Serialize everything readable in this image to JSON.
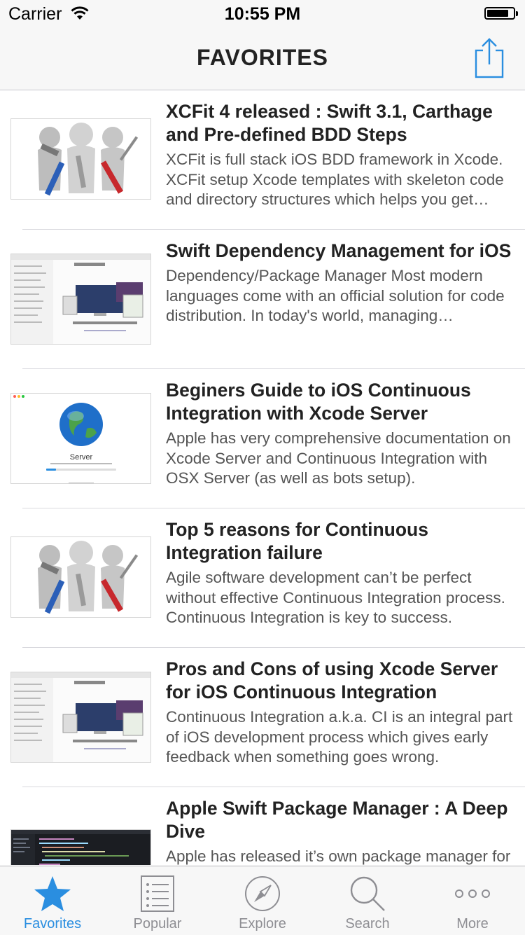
{
  "status_bar": {
    "carrier": "Carrier",
    "time": "10:55 PM"
  },
  "nav": {
    "title": "FAVORITES",
    "share_icon": "share-icon"
  },
  "articles": [
    {
      "title": "XCFit 4 released : Swift 3.1, Carthage and Pre-defined BDD Steps",
      "description": "XCFit is full stack iOS BDD framework in Xcode. XCFit setup Xcode templates with skeleton code and directory structures which helps you get started quickly.",
      "thumbnail": "team-tools-figures"
    },
    {
      "title": "Swift Dependency Management for iOS",
      "description": "Dependency/Package Manager Most modern languages come with an official solution for code distribution. In today's world, managing dependencies is essential.",
      "thumbnail": "macos-server-window"
    },
    {
      "title": "Beginers Guide to iOS Continuous Integration with Xcode Server",
      "description": "Apple has very comprehensive documentation on Xcode Server and Continuous Integration with OSX Server (as well as bots setup).",
      "thumbnail": "server-globe-window",
      "thumbnail_label": "Server"
    },
    {
      "title": "Top 5 reasons for Continuous Integration failure",
      "description": "Agile software development can’t be perfect without effective Continuous Integration process. Continuous Integration is key to success.",
      "thumbnail": "team-tools-figures"
    },
    {
      "title": "Pros and Cons of using Xcode Server for iOS Continuous Integration",
      "description": "Continuous Integration a.k.a. CI is an integral part of iOS development process which gives early feedback when something goes wrong.",
      "thumbnail": "macos-server-window"
    },
    {
      "title": "Apple Swift Package Manager : A Deep Dive",
      "description": "Apple has released it’s own package manager for Swift.",
      "thumbnail": "code-editor-dark"
    }
  ],
  "tabs": [
    {
      "label": "Favorites",
      "icon": "star-icon",
      "active": true
    },
    {
      "label": "Popular",
      "icon": "list-icon",
      "active": false
    },
    {
      "label": "Explore",
      "icon": "compass-icon",
      "active": false
    },
    {
      "label": "Search",
      "icon": "search-icon",
      "active": false
    },
    {
      "label": "More",
      "icon": "more-icon",
      "active": false
    }
  ],
  "colors": {
    "accent": "#2a8ee0",
    "inactive": "#8e8e93",
    "bar_background": "#f7f7f7"
  }
}
